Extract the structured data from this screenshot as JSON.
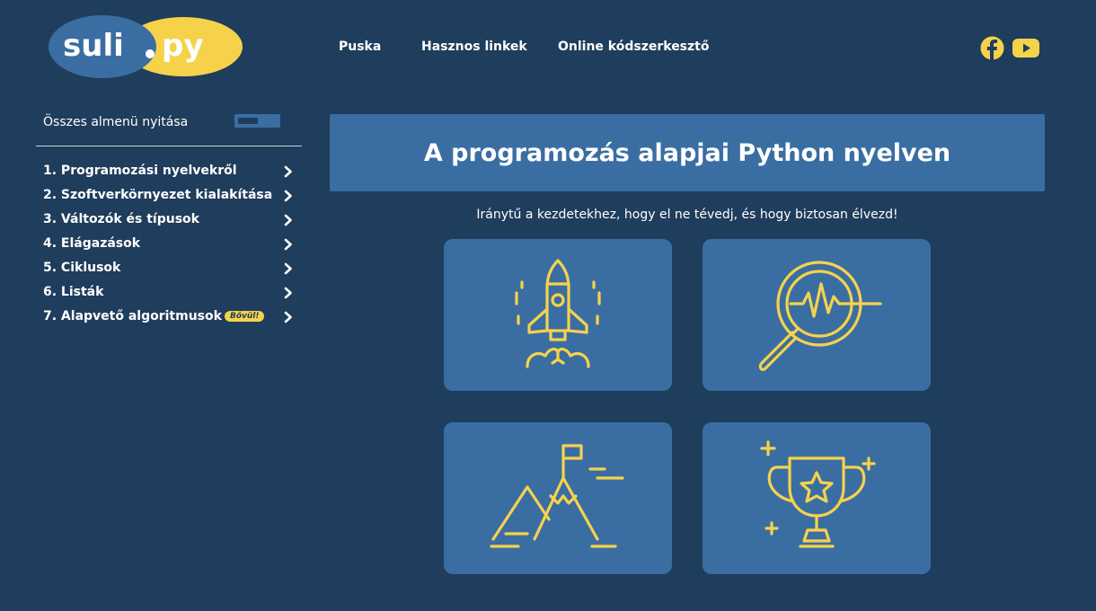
{
  "logo": {
    "part1": "suli",
    "part2": "py"
  },
  "nav": [
    {
      "label": "Puska"
    },
    {
      "label": "Hasznos linkek"
    },
    {
      "label": "Online kódszerkesztő"
    }
  ],
  "social": {
    "facebook_icon": "facebook-icon",
    "youtube_icon": "youtube-icon"
  },
  "sidebar": {
    "toggle_label": "Összes almenü nyitása",
    "items": [
      {
        "label": "1. Programozási nyelvekről"
      },
      {
        "label": "2. Szoftverkörnyezet kialakítása"
      },
      {
        "label": "3. Változók és típusok"
      },
      {
        "label": "4. Elágazások"
      },
      {
        "label": "5. Ciklusok"
      },
      {
        "label": "6. Listák"
      },
      {
        "label": "7. Alapvető algoritmusok",
        "badge": "Bővül!"
      }
    ]
  },
  "main": {
    "title": "A programozás alapjai Python nyelven",
    "subtitle": "Iránytű a kezdetekhez, hogy el ne tévedj, és hogy biztosan élvezd!",
    "cards": [
      {
        "icon": "rocket-icon"
      },
      {
        "icon": "magnifier-pulse-icon"
      },
      {
        "icon": "mountain-flag-icon"
      },
      {
        "icon": "trophy-star-icon"
      }
    ]
  },
  "colors": {
    "background": "#1f3d5c",
    "panel": "#3a6ea3",
    "accent_yellow": "#f6d24b",
    "text": "#ffffff"
  }
}
